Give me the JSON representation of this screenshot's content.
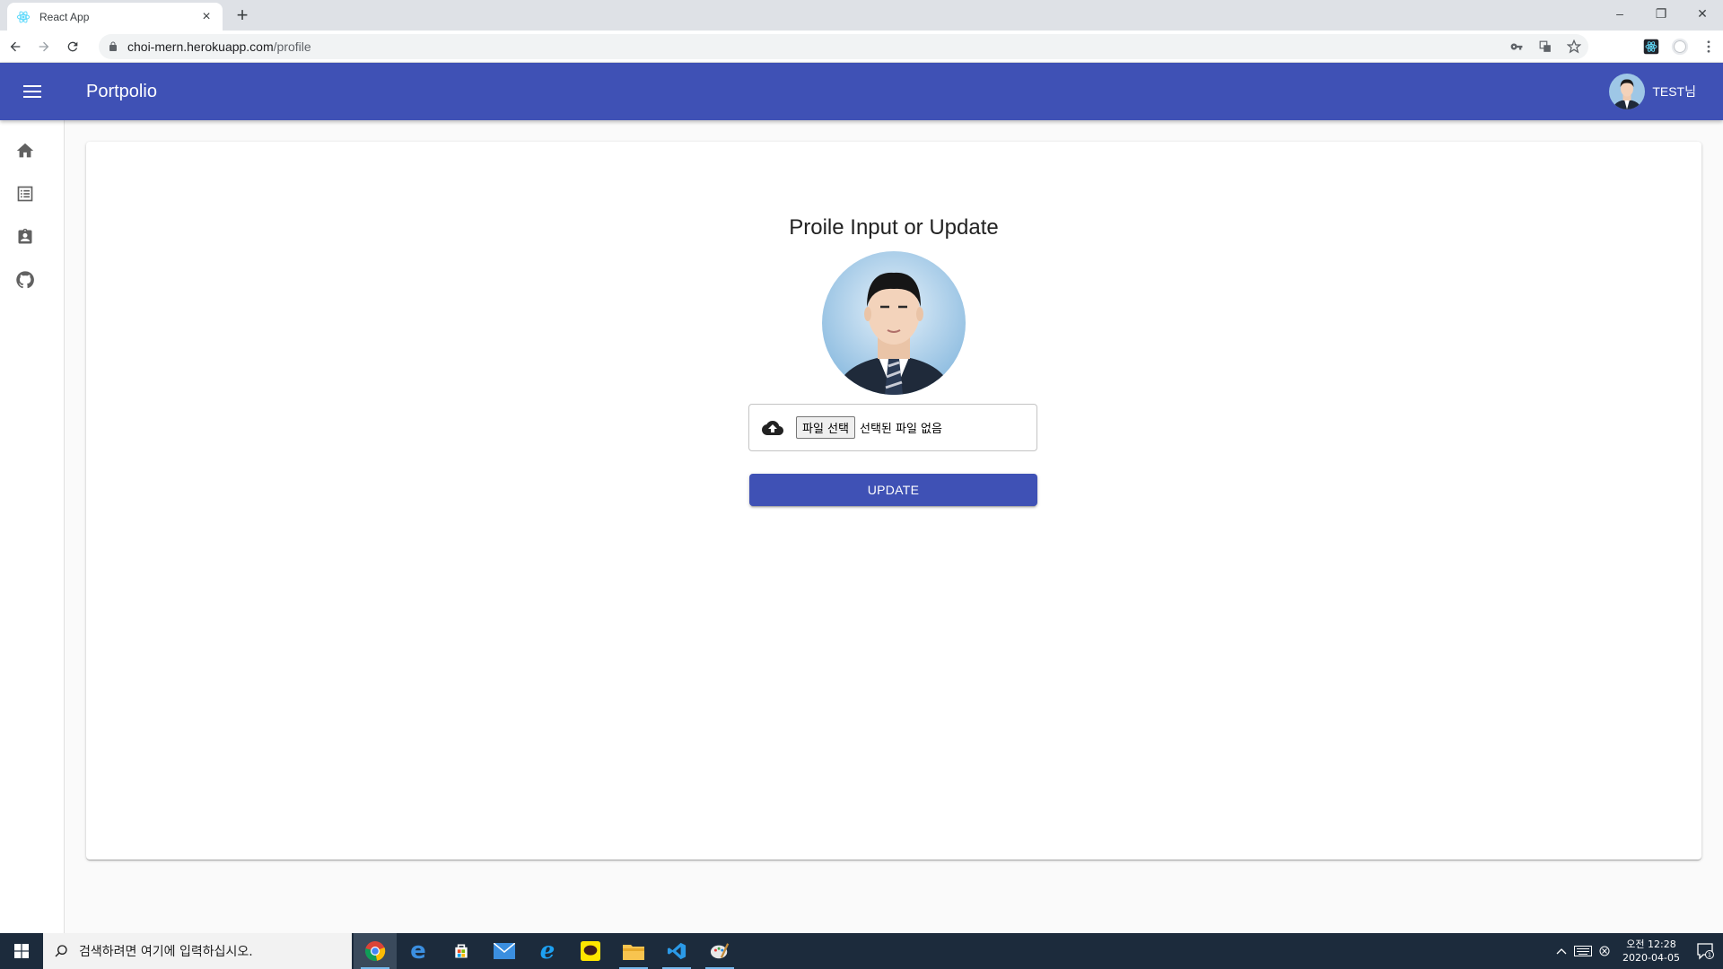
{
  "browser": {
    "tab_title": "React App",
    "tab_close": "×",
    "new_tab": "+",
    "url_host": "choi-mern.herokuapp.com",
    "url_path": "/profile",
    "window_controls": [
      "–",
      "❐",
      "✕"
    ]
  },
  "appbar": {
    "title": "Portpolio",
    "user_name": "TEST님"
  },
  "sidebar": {
    "items": [
      {
        "icon": "home-icon"
      },
      {
        "icon": "list-icon"
      },
      {
        "icon": "contact-icon"
      },
      {
        "icon": "github-icon"
      }
    ]
  },
  "profile": {
    "title": "Proile Input or Update",
    "file_button": "파일 선택",
    "file_status": "선택된 파일 없음",
    "update_label": "UPDATE"
  },
  "taskbar": {
    "search_placeholder": "검색하려면 여기에 입력하십시오.",
    "time": "오전 12:28",
    "date": "2020-04-05",
    "notif_count": "1"
  },
  "colors": {
    "primary": "#3f51b5",
    "taskbar": "#1c2b3c"
  }
}
